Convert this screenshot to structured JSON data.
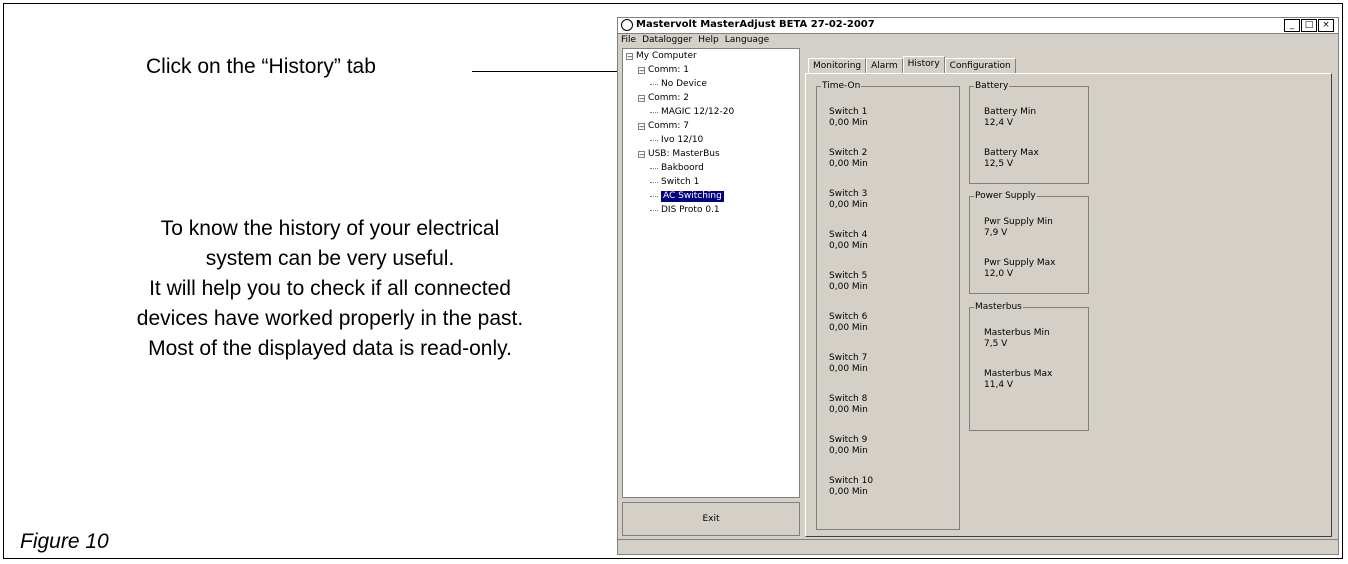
{
  "annotation": {
    "instruction": "Click on the “History” tab",
    "description": [
      "To know the history of your electrical",
      "system can be very useful.",
      "It will help you to check if all connected",
      "devices have worked properly in the past.",
      "Most of the displayed data is read-only."
    ],
    "figure": "Figure 10"
  },
  "window": {
    "title": "Mastervolt MasterAdjust BETA 27-02-2007",
    "buttons": [
      "_",
      "□",
      "×"
    ],
    "menu": [
      "File",
      "Datalogger",
      "Help",
      "Language"
    ]
  },
  "tree": {
    "items": [
      {
        "label": "My Computer",
        "expander": "−"
      },
      {
        "label": "Comm: 1",
        "expander": "−"
      },
      {
        "label": "No Device",
        "expander": ""
      },
      {
        "label": "Comm: 2",
        "expander": "−"
      },
      {
        "label": "MAGIC 12/12-20",
        "expander": ""
      },
      {
        "label": "Comm: 7",
        "expander": "−"
      },
      {
        "label": "Ivo 12/10",
        "expander": ""
      },
      {
        "label": "USB: MasterBus",
        "expander": "−"
      },
      {
        "label": "Bakboord",
        "expander": ""
      },
      {
        "label": "Switch 1",
        "expander": ""
      },
      {
        "label": "AC Switching",
        "expander": "",
        "selected": true
      },
      {
        "label": "DIS Proto 0.1",
        "expander": ""
      }
    ]
  },
  "exit_label": "Exit",
  "tabs": [
    "Monitoring",
    "Alarm",
    "History",
    "Configuration"
  ],
  "active_tab": "History",
  "time_on": {
    "title": "Time-On",
    "items": [
      {
        "label": "Switch 1",
        "value": "0,00 Min"
      },
      {
        "label": "Switch 2",
        "value": "0,00 Min"
      },
      {
        "label": "Switch 3",
        "value": "0,00 Min"
      },
      {
        "label": "Switch 4",
        "value": "0,00 Min"
      },
      {
        "label": "Switch 5",
        "value": "0,00 Min"
      },
      {
        "label": "Switch 6",
        "value": "0,00 Min"
      },
      {
        "label": "Switch 7",
        "value": "0,00 Min"
      },
      {
        "label": "Switch 8",
        "value": "0,00 Min"
      },
      {
        "label": "Switch 9",
        "value": "0,00 Min"
      },
      {
        "label": "Switch 10",
        "value": "0,00 Min"
      }
    ]
  },
  "battery": {
    "title": "Battery",
    "items": [
      {
        "label": "Battery Min",
        "value": "12,4 V"
      },
      {
        "label": "Battery Max",
        "value": "12,5 V"
      }
    ]
  },
  "power_supply": {
    "title": "Power Supply",
    "items": [
      {
        "label": "Pwr Supply Min",
        "value": "7,9 V"
      },
      {
        "label": "Pwr Supply Max",
        "value": "12,0 V"
      }
    ]
  },
  "masterbus": {
    "title": "Masterbus",
    "items": [
      {
        "label": "Masterbus Min",
        "value": "7,5 V"
      },
      {
        "label": "Masterbus Max",
        "value": "11,4 V"
      }
    ]
  }
}
